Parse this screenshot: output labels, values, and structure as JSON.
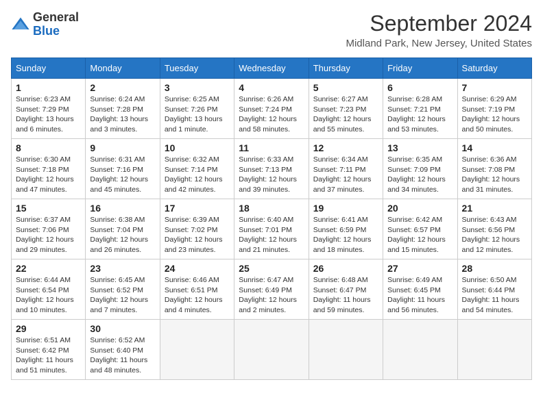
{
  "logo": {
    "line1": "General",
    "line2": "Blue"
  },
  "title": "September 2024",
  "location": "Midland Park, New Jersey, United States",
  "days_of_week": [
    "Sunday",
    "Monday",
    "Tuesday",
    "Wednesday",
    "Thursday",
    "Friday",
    "Saturday"
  ],
  "weeks": [
    [
      {
        "day": 1,
        "info": "Sunrise: 6:23 AM\nSunset: 7:29 PM\nDaylight: 13 hours\nand 6 minutes."
      },
      {
        "day": 2,
        "info": "Sunrise: 6:24 AM\nSunset: 7:28 PM\nDaylight: 13 hours\nand 3 minutes."
      },
      {
        "day": 3,
        "info": "Sunrise: 6:25 AM\nSunset: 7:26 PM\nDaylight: 13 hours\nand 1 minute."
      },
      {
        "day": 4,
        "info": "Sunrise: 6:26 AM\nSunset: 7:24 PM\nDaylight: 12 hours\nand 58 minutes."
      },
      {
        "day": 5,
        "info": "Sunrise: 6:27 AM\nSunset: 7:23 PM\nDaylight: 12 hours\nand 55 minutes."
      },
      {
        "day": 6,
        "info": "Sunrise: 6:28 AM\nSunset: 7:21 PM\nDaylight: 12 hours\nand 53 minutes."
      },
      {
        "day": 7,
        "info": "Sunrise: 6:29 AM\nSunset: 7:19 PM\nDaylight: 12 hours\nand 50 minutes."
      }
    ],
    [
      {
        "day": 8,
        "info": "Sunrise: 6:30 AM\nSunset: 7:18 PM\nDaylight: 12 hours\nand 47 minutes."
      },
      {
        "day": 9,
        "info": "Sunrise: 6:31 AM\nSunset: 7:16 PM\nDaylight: 12 hours\nand 45 minutes."
      },
      {
        "day": 10,
        "info": "Sunrise: 6:32 AM\nSunset: 7:14 PM\nDaylight: 12 hours\nand 42 minutes."
      },
      {
        "day": 11,
        "info": "Sunrise: 6:33 AM\nSunset: 7:13 PM\nDaylight: 12 hours\nand 39 minutes."
      },
      {
        "day": 12,
        "info": "Sunrise: 6:34 AM\nSunset: 7:11 PM\nDaylight: 12 hours\nand 37 minutes."
      },
      {
        "day": 13,
        "info": "Sunrise: 6:35 AM\nSunset: 7:09 PM\nDaylight: 12 hours\nand 34 minutes."
      },
      {
        "day": 14,
        "info": "Sunrise: 6:36 AM\nSunset: 7:08 PM\nDaylight: 12 hours\nand 31 minutes."
      }
    ],
    [
      {
        "day": 15,
        "info": "Sunrise: 6:37 AM\nSunset: 7:06 PM\nDaylight: 12 hours\nand 29 minutes."
      },
      {
        "day": 16,
        "info": "Sunrise: 6:38 AM\nSunset: 7:04 PM\nDaylight: 12 hours\nand 26 minutes."
      },
      {
        "day": 17,
        "info": "Sunrise: 6:39 AM\nSunset: 7:02 PM\nDaylight: 12 hours\nand 23 minutes."
      },
      {
        "day": 18,
        "info": "Sunrise: 6:40 AM\nSunset: 7:01 PM\nDaylight: 12 hours\nand 21 minutes."
      },
      {
        "day": 19,
        "info": "Sunrise: 6:41 AM\nSunset: 6:59 PM\nDaylight: 12 hours\nand 18 minutes."
      },
      {
        "day": 20,
        "info": "Sunrise: 6:42 AM\nSunset: 6:57 PM\nDaylight: 12 hours\nand 15 minutes."
      },
      {
        "day": 21,
        "info": "Sunrise: 6:43 AM\nSunset: 6:56 PM\nDaylight: 12 hours\nand 12 minutes."
      }
    ],
    [
      {
        "day": 22,
        "info": "Sunrise: 6:44 AM\nSunset: 6:54 PM\nDaylight: 12 hours\nand 10 minutes."
      },
      {
        "day": 23,
        "info": "Sunrise: 6:45 AM\nSunset: 6:52 PM\nDaylight: 12 hours\nand 7 minutes."
      },
      {
        "day": 24,
        "info": "Sunrise: 6:46 AM\nSunset: 6:51 PM\nDaylight: 12 hours\nand 4 minutes."
      },
      {
        "day": 25,
        "info": "Sunrise: 6:47 AM\nSunset: 6:49 PM\nDaylight: 12 hours\nand 2 minutes."
      },
      {
        "day": 26,
        "info": "Sunrise: 6:48 AM\nSunset: 6:47 PM\nDaylight: 11 hours\nand 59 minutes."
      },
      {
        "day": 27,
        "info": "Sunrise: 6:49 AM\nSunset: 6:45 PM\nDaylight: 11 hours\nand 56 minutes."
      },
      {
        "day": 28,
        "info": "Sunrise: 6:50 AM\nSunset: 6:44 PM\nDaylight: 11 hours\nand 54 minutes."
      }
    ],
    [
      {
        "day": 29,
        "info": "Sunrise: 6:51 AM\nSunset: 6:42 PM\nDaylight: 11 hours\nand 51 minutes."
      },
      {
        "day": 30,
        "info": "Sunrise: 6:52 AM\nSunset: 6:40 PM\nDaylight: 11 hours\nand 48 minutes."
      },
      null,
      null,
      null,
      null,
      null
    ]
  ]
}
